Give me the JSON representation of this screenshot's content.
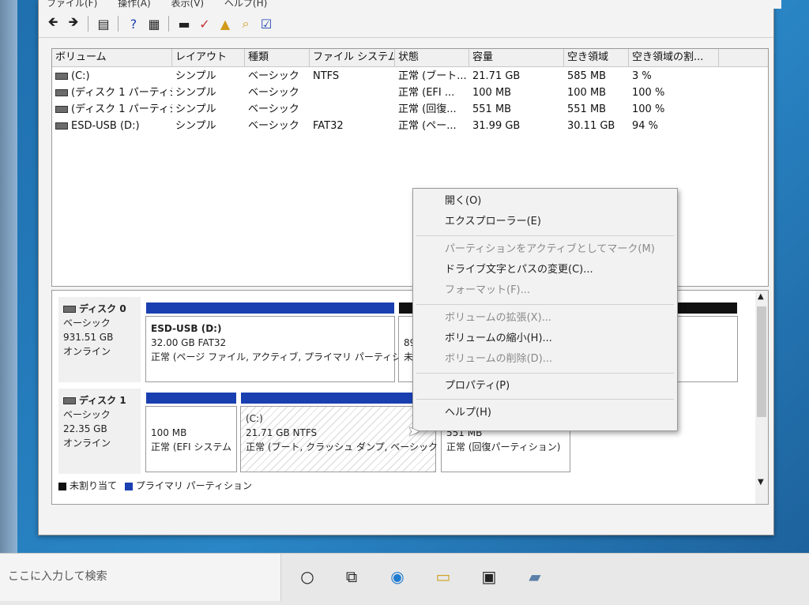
{
  "menubar": {
    "items": [
      "ファイル(F)",
      "操作(A)",
      "表示(V)",
      "ヘルプ(H)"
    ]
  },
  "toolbar": {
    "icons": [
      "back-arrow-icon",
      "forward-arrow-icon",
      "properties-icon",
      "help-icon",
      "show-hide-icon",
      "drive-icon",
      "check-doc-icon",
      "folder-up-icon",
      "search-folder-icon",
      "list-check-icon"
    ]
  },
  "volumeList": {
    "columns": [
      "ボリューム",
      "レイアウト",
      "種類",
      "ファイル システム",
      "状態",
      "容量",
      "空き領域",
      "空き領域の割..."
    ],
    "rows": [
      [
        "(C:)",
        "シンプル",
        "ベーシック",
        "NTFS",
        "正常 (ブート...",
        "21.71 GB",
        "585 MB",
        "3 %"
      ],
      [
        "(ディスク 1 パーティシ...",
        "シンプル",
        "ベーシック",
        "",
        "正常 (EFI ...",
        "100 MB",
        "100 MB",
        "100 %"
      ],
      [
        "(ディスク 1 パーティシ...",
        "シンプル",
        "ベーシック",
        "",
        "正常 (回復...",
        "551 MB",
        "551 MB",
        "100 %"
      ],
      [
        "ESD-USB (D:)",
        "シンプル",
        "ベーシック",
        "FAT32",
        "正常 (ペー...",
        "31.99 GB",
        "30.11 GB",
        "94 %"
      ]
    ]
  },
  "disks": {
    "disk0": {
      "name": "ディスク 0",
      "type": "ベーシック",
      "size": "931.51 GB",
      "status": "オンライン",
      "partitions": [
        {
          "title": "ESD-USB (D:)",
          "line1": "32.00 GB FAT32",
          "line2": "正常 (ページ ファイル, アクティブ, プライマリ パーティショ"
        },
        {
          "title": "",
          "line1": "89",
          "line2": "未"
        }
      ]
    },
    "disk1": {
      "name": "ディスク 1",
      "type": "ベーシック",
      "size": "22.35 GB",
      "status": "オンライン",
      "partitions": [
        {
          "title": "",
          "line1": "100 MB",
          "line2": "正常 (EFI システム"
        },
        {
          "title": "(C:)",
          "line1": "21.71 GB NTFS",
          "line2": "正常 (ブート, クラッシュ ダンプ, ベーシック デ"
        },
        {
          "title": "",
          "line1": "551 MB",
          "line2": "正常 (回復パーティション)"
        }
      ]
    }
  },
  "legend": {
    "unallocated": "未割り当て",
    "primary": "プライマリ パーティション"
  },
  "contextMenu": {
    "items": [
      {
        "label": "開く(O)",
        "disabled": false
      },
      {
        "label": "エクスプローラー(E)",
        "disabled": false
      },
      {
        "label": "パーティションをアクティブとしてマーク(M)",
        "disabled": true
      },
      {
        "label": "ドライブ文字とパスの変更(C)...",
        "disabled": false
      },
      {
        "label": "フォーマット(F)...",
        "disabled": true
      },
      {
        "label": "ボリュームの拡張(X)...",
        "disabled": true
      },
      {
        "label": "ボリュームの縮小(H)...",
        "disabled": false
      },
      {
        "label": "ボリュームの削除(D)...",
        "disabled": true
      },
      {
        "label": "プロパティ(P)",
        "disabled": false
      },
      {
        "label": "ヘルプ(H)",
        "disabled": false
      }
    ]
  },
  "taskbar": {
    "search_placeholder": "ここに入力して検索"
  },
  "colors": {
    "primary_partition": "#1a3fb0",
    "unallocated": "#111111"
  }
}
